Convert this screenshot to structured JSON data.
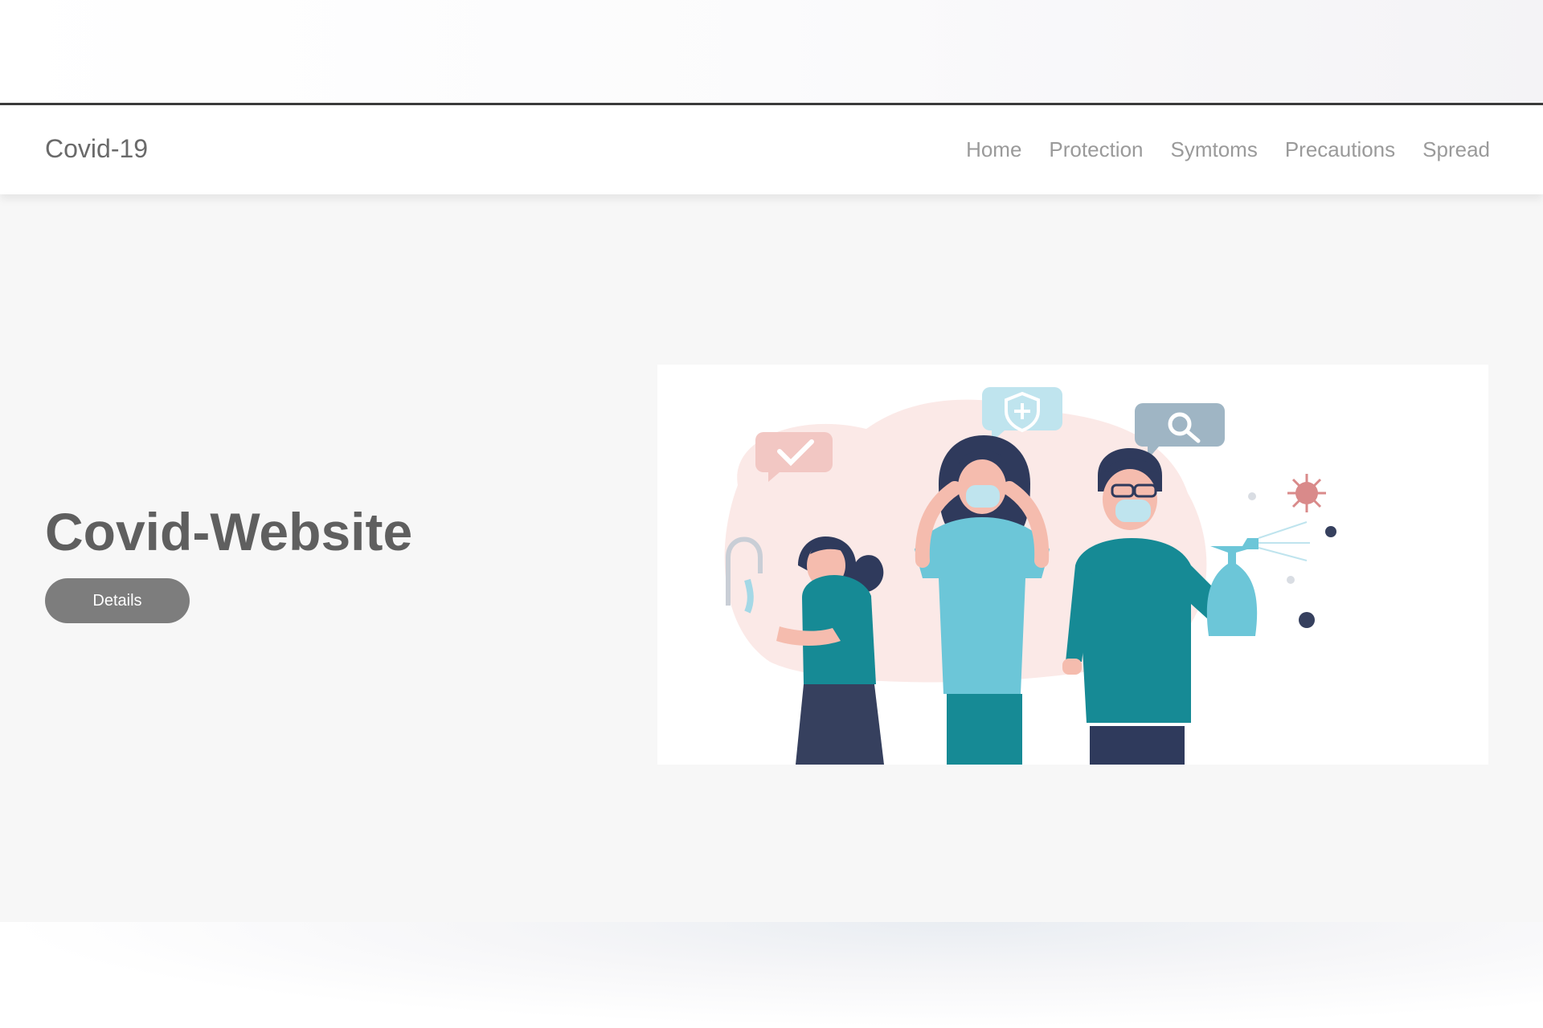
{
  "brand": "Covid-19",
  "nav": {
    "items": [
      {
        "label": "Home"
      },
      {
        "label": "Protection"
      },
      {
        "label": "Symtoms"
      },
      {
        "label": "Precautions"
      },
      {
        "label": "Spread"
      }
    ]
  },
  "hero": {
    "title": "Covid-Website",
    "button_label": "Details"
  },
  "colors": {
    "teal_shirt": "#168a95",
    "light_blue": "#6cc6d8",
    "navy": "#36405e",
    "pink_bg": "#fbe9e7",
    "virus": "#d98a8a"
  }
}
